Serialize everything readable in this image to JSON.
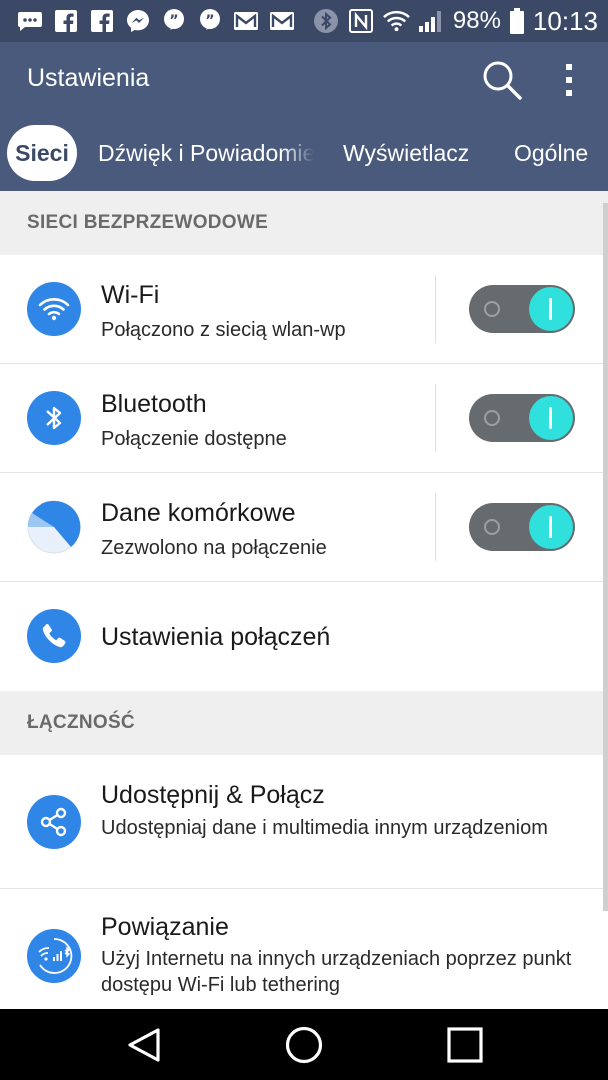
{
  "status_bar": {
    "battery": "98%",
    "time": "10:13"
  },
  "header": {
    "title": "Ustawienia"
  },
  "tabs": [
    {
      "label": "Sieci",
      "active": true
    },
    {
      "label": "Dźwięk i Powiadomienia",
      "active": false
    },
    {
      "label": "Wyświetlacz",
      "active": false
    },
    {
      "label": "Ogólne",
      "active": false
    }
  ],
  "sections": [
    {
      "header": "SIECI BEZPRZEWODOWE"
    },
    {
      "header": "ŁĄCZNOŚĆ"
    }
  ],
  "items": [
    {
      "title": "Wi-Fi",
      "subtitle": "Połączono z siecią wlan-wp",
      "toggle_on": true
    },
    {
      "title": "Bluetooth",
      "subtitle": "Połączenie dostępne",
      "toggle_on": true
    },
    {
      "title": "Dane komórkowe",
      "subtitle": "Zezwolono na połączenie",
      "toggle_on": true
    },
    {
      "title": "Ustawienia połączeń"
    },
    {
      "title": "Udostępnij & Połącz",
      "subtitle": "Udostępniaj dane i multimedia innym urządzeniom"
    },
    {
      "title": "Powiązanie",
      "subtitle": "Użyj Internetu na innych urządzeniach poprzez punkt dostępu Wi-Fi lub tethering"
    }
  ],
  "colors": {
    "status_bar": "#3b4966",
    "header": "#4a5a7c",
    "accent_icon": "#2f86e6",
    "toggle_knob": "#2fe0dc"
  }
}
